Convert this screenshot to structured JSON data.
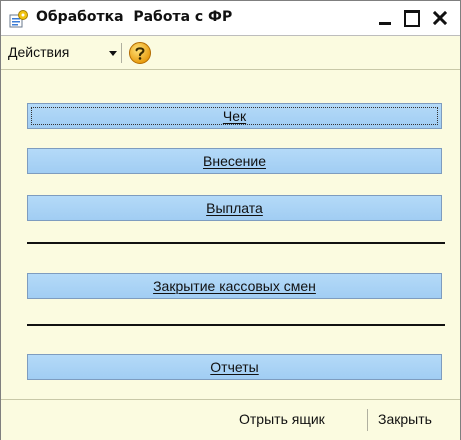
{
  "window": {
    "title": "Обработка  Работа с ФР",
    "accent": "#a8d2f6",
    "background": "#fbfbe0"
  },
  "toolbar": {
    "actions_label": "Действия",
    "help_icon": "help-icon"
  },
  "buttons": {
    "check": {
      "text": "Чек"
    },
    "deposit": {
      "text": "Внесение"
    },
    "payout": {
      "text": "Выплата"
    },
    "close_shifts": {
      "text": "Закрытие кассовых смен"
    },
    "reports": {
      "text": "Отчеты"
    }
  },
  "footer": {
    "open_drawer": "Отрыть ящик",
    "close": "Закрыть"
  }
}
